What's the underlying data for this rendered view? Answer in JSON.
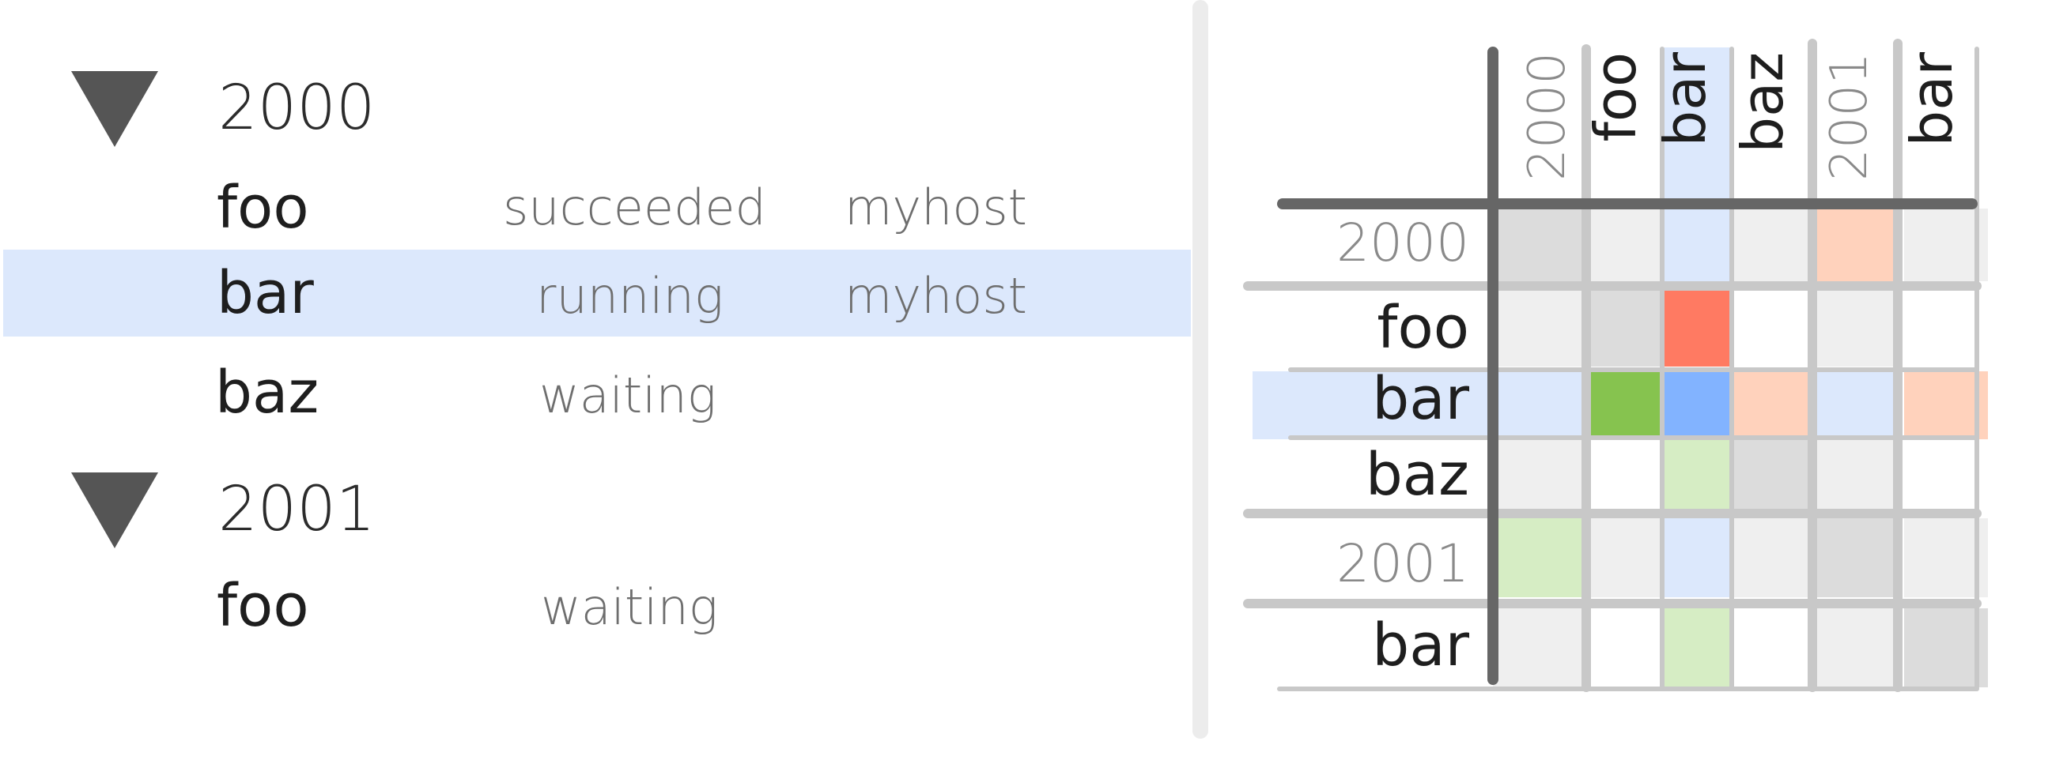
{
  "tree": {
    "groups": [
      {
        "label": "2000",
        "tasks": [
          {
            "name": "foo",
            "status": "succeeded",
            "host": "myhost"
          },
          {
            "name": "bar",
            "status": "running",
            "host": "myhost",
            "selected": true
          },
          {
            "name": "baz",
            "status": "waiting",
            "host": ""
          }
        ]
      },
      {
        "label": "2001",
        "tasks": [
          {
            "name": "foo",
            "status": "waiting",
            "host": ""
          }
        ]
      }
    ],
    "icon": "triangle-down-icon"
  },
  "matrix": {
    "columns": [
      "2000",
      "foo",
      "bar",
      "baz",
      "2001",
      "bar"
    ],
    "rows": [
      "2000",
      "foo",
      "bar",
      "baz",
      "2001",
      "bar"
    ],
    "group_indices": [
      0,
      4
    ],
    "highlight_index": 2,
    "cells": [
      [
        "group",
        "light",
        "sel",
        "light",
        "salmon",
        "light"
      ],
      [
        "light",
        "group",
        "red",
        "white",
        "light",
        "white"
      ],
      [
        "sel",
        "green",
        "blue",
        "salmon",
        "sel",
        "salmon"
      ],
      [
        "light",
        "white",
        "lightgreen",
        "group",
        "light",
        "white"
      ],
      [
        "lightgreen",
        "light",
        "sel",
        "light",
        "group",
        "light"
      ],
      [
        "light",
        "white",
        "lightgreen",
        "white",
        "light",
        "group"
      ]
    ],
    "colors": {
      "white": "#ffffff",
      "light": "#efefef",
      "group": "#dcdcdc",
      "sel": "#dce8fc",
      "salmon": "#ffd2bc",
      "red": "#ff7a62",
      "green": "#86c34f",
      "blue": "#82b3ff",
      "lightgreen": "#d6edc4",
      "highlight": "#dce8fc",
      "grid_light": "#c8c8c8",
      "grid_dark": "#666666",
      "group_text": "#8a8a8a",
      "task_text": "#1e1e1e"
    }
  }
}
